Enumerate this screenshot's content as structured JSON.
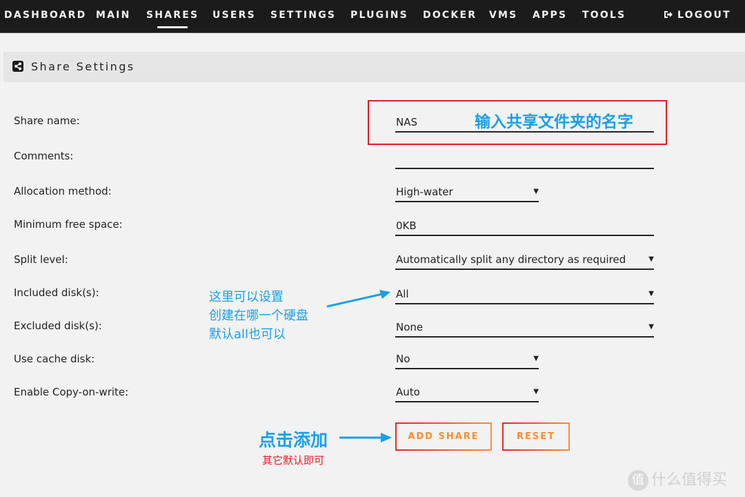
{
  "nav": {
    "items": [
      {
        "label": "DASHBOARD",
        "active": false
      },
      {
        "label": "MAIN",
        "active": false
      },
      {
        "label": "SHARES",
        "active": true
      },
      {
        "label": "USERS",
        "active": false
      },
      {
        "label": "SETTINGS",
        "active": false
      },
      {
        "label": "PLUGINS",
        "active": false
      },
      {
        "label": "DOCKER",
        "active": false
      },
      {
        "label": "VMS",
        "active": false
      },
      {
        "label": "APPS",
        "active": false
      },
      {
        "label": "TOOLS",
        "active": false
      }
    ],
    "logout_label": "LOGOUT",
    "logout_icon": "logout-icon"
  },
  "section": {
    "title": "Share Settings",
    "icon": "share-icon"
  },
  "form": {
    "share_name": {
      "label": "Share name:",
      "value": "NAS"
    },
    "comments": {
      "label": "Comments:",
      "value": ""
    },
    "allocation_method": {
      "label": "Allocation method:",
      "value": "High-water"
    },
    "min_free_space": {
      "label": "Minimum free space:",
      "value": "0KB"
    },
    "split_level": {
      "label": "Split level:",
      "value": "Automatically split any directory as required"
    },
    "included_disks": {
      "label": "Included disk(s):",
      "value": "All"
    },
    "excluded_disks": {
      "label": "Excluded disk(s):",
      "value": "None"
    },
    "use_cache": {
      "label": "Use cache disk:",
      "value": "No"
    },
    "copy_on_write": {
      "label": "Enable Copy-on-write:",
      "value": "Auto"
    }
  },
  "buttons": {
    "add_share": "ADD SHARE",
    "reset": "RESET"
  },
  "annotations": {
    "share_name_hint": "输入共享文件夹的名字",
    "disk_hint_line1": "这里可以设置",
    "disk_hint_line2": "创建在哪一个硬盘",
    "disk_hint_line3": "默认all也可以",
    "click_add": "点击添加",
    "others_default": "其它默认即可"
  },
  "colors": {
    "nav_bg": "#1c1b1b",
    "accent_orange": "#ff8c2f",
    "accent_red": "#e22828",
    "annotation_blue": "#1aa0e8",
    "annotation_red": "#e8191f"
  },
  "watermark": {
    "glyph": "值",
    "text": "什么值得买"
  }
}
